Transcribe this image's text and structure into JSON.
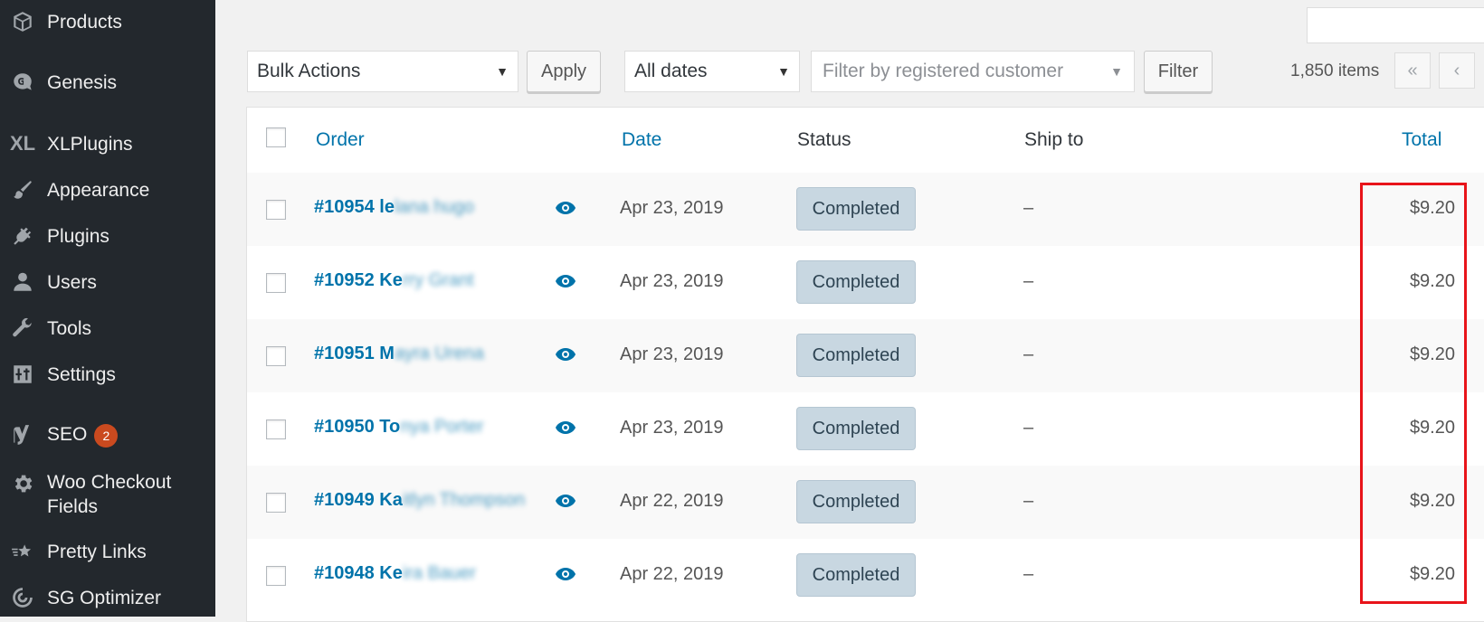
{
  "sidebar": {
    "items": [
      {
        "label": "Products",
        "icon": "products-icon"
      },
      {
        "label": "Genesis",
        "icon": "genesis-icon"
      },
      {
        "label": "XLPlugins",
        "icon": "xlplugins-icon",
        "icon_text": "XL"
      },
      {
        "label": "Appearance",
        "icon": "paintbrush-icon"
      },
      {
        "label": "Plugins",
        "icon": "plug-icon"
      },
      {
        "label": "Users",
        "icon": "user-icon"
      },
      {
        "label": "Tools",
        "icon": "wrench-icon"
      },
      {
        "label": "Settings",
        "icon": "settings-sliders-icon"
      },
      {
        "label": "SEO",
        "icon": "yoast-icon",
        "badge": "2"
      },
      {
        "label": "Woo Checkout Fields",
        "icon": "gear-icon"
      },
      {
        "label": "Pretty Links",
        "icon": "star-link-icon"
      },
      {
        "label": "SG Optimizer",
        "icon": "sg-optimizer-icon"
      }
    ]
  },
  "toolbar": {
    "bulk_actions": "Bulk Actions",
    "apply_label": "Apply",
    "dates_filter": "All dates",
    "customer_filter_placeholder": "Filter by registered customer",
    "filter_label": "Filter",
    "items_count": "1,850 items",
    "first_page": "«",
    "prev_page": "‹"
  },
  "table": {
    "columns": {
      "order": "Order",
      "date": "Date",
      "status": "Status",
      "ship_to": "Ship to",
      "total": "Total"
    },
    "rows": [
      {
        "order": "#10954 le",
        "name_blurred": "lana hugo",
        "date": "Apr 23, 2019",
        "status": "Completed",
        "ship_to": "–",
        "total": "$9.20"
      },
      {
        "order": "#10952 Ke",
        "name_blurred": "rry Grant",
        "date": "Apr 23, 2019",
        "status": "Completed",
        "ship_to": "–",
        "total": "$9.20"
      },
      {
        "order": "#10951 M",
        "name_blurred": "ayra Urena",
        "date": "Apr 23, 2019",
        "status": "Completed",
        "ship_to": "–",
        "total": "$9.20"
      },
      {
        "order": "#10950 To",
        "name_blurred": "nya Porter",
        "date": "Apr 23, 2019",
        "status": "Completed",
        "ship_to": "–",
        "total": "$9.20"
      },
      {
        "order": "#10949 Ka",
        "name_blurred": "itlyn Thompson",
        "date": "Apr 22, 2019",
        "status": "Completed",
        "ship_to": "–",
        "total": "$9.20"
      },
      {
        "order": "#10948 Ke",
        "name_blurred": "ira Bauer",
        "date": "Apr 22, 2019",
        "status": "Completed",
        "ship_to": "–",
        "total": "$9.20"
      }
    ]
  },
  "colors": {
    "sidebar_bg": "#23282d",
    "link": "#0073aa",
    "status_completed_bg": "#c8d7e1",
    "highlight_border": "#e8141a",
    "badge_bg": "#ca4a1f"
  }
}
